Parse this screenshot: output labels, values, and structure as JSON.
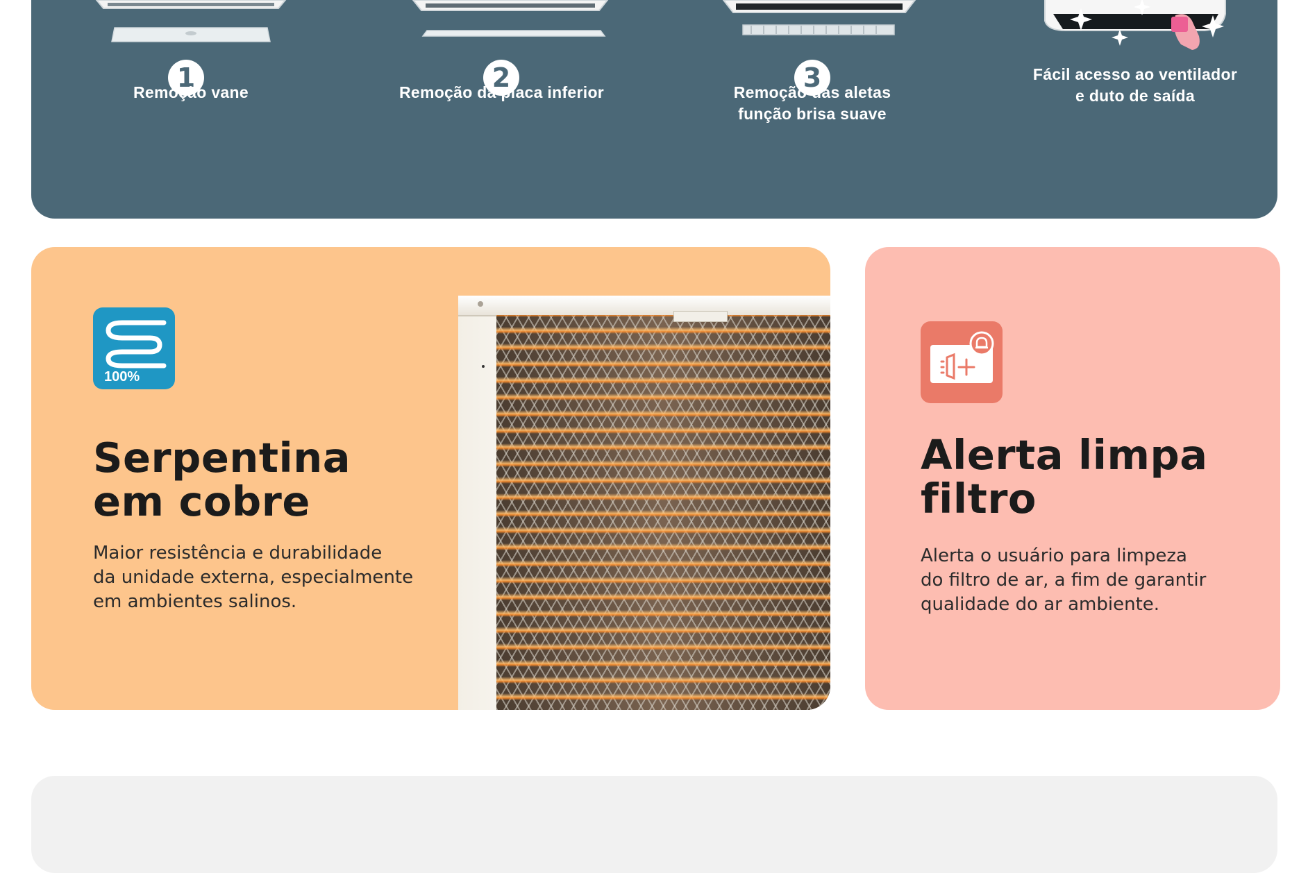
{
  "removal_steps": [
    {
      "number": "1",
      "label": "Remoção vane"
    },
    {
      "number": "2",
      "label": "Remoção da placa inferior"
    },
    {
      "number": "3",
      "label": "Remoção das aletas\nfunção brisa suave"
    },
    {
      "number": "",
      "label": "Fácil acesso ao ventilador\ne duto de saída"
    }
  ],
  "copper_card": {
    "icon_caption": "100%",
    "title": "Serpentina\nem cobre",
    "body": "Maior resistência e durabilidade\nda unidade externa, especialmente\nem ambientes salinos."
  },
  "filter_card": {
    "title": "Alerta limpa\nfiltro",
    "body": "Alerta o usuário para limpeza\ndo filtro de ar, a fim de garantir\nqualidade do ar ambiente."
  },
  "colors": {
    "top_panel": "#4b6877",
    "copper_card": "#fdc58c",
    "filter_card": "#fdbdb1",
    "copper_icon": "#1f97c4",
    "filter_icon": "#ea7a68",
    "bottom_panel": "#f1f1f1"
  },
  "icons": {
    "copper": "copper-coil-icon",
    "filter": "filter-alert-icon"
  }
}
